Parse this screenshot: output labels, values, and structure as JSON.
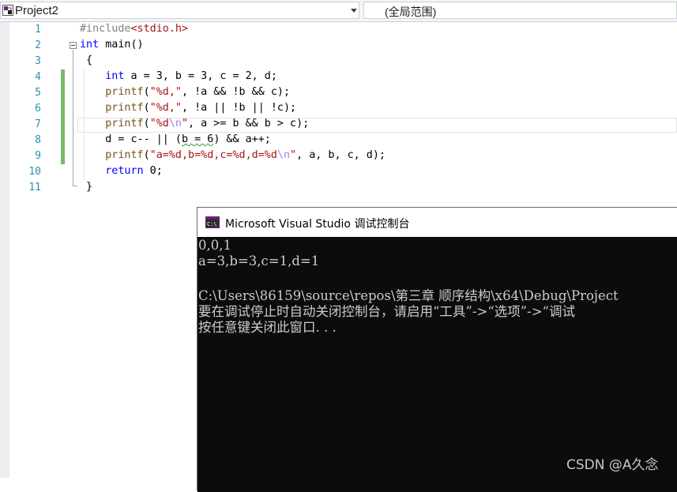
{
  "navbar": {
    "project": "Project2",
    "scope": "(全局范围)",
    "project_icon": "project-icon"
  },
  "editor": {
    "lines": [
      {
        "num": "1",
        "code": "#include<stdio.h>"
      },
      {
        "num": "2",
        "code": "int main()"
      },
      {
        "num": "3",
        "code": "{"
      },
      {
        "num": "4",
        "code": "int a = 3, b = 3, c = 2, d;"
      },
      {
        "num": "5",
        "code": "printf(\"%d,\", !a && !b && c);"
      },
      {
        "num": "6",
        "code": "printf(\"%d,\", !a || !b || !c);"
      },
      {
        "num": "7",
        "code": "printf(\"%d\\n\", a >= b && b > c);"
      },
      {
        "num": "8",
        "code": "d = c-- || (b = 6) && a++;"
      },
      {
        "num": "9",
        "code": "printf(\"a=%d,b=%d,c=%d,d=%d\\n\", a, b, c, d);"
      },
      {
        "num": "10",
        "code": "return 0;"
      },
      {
        "num": "11",
        "code": "}"
      }
    ],
    "colors": {
      "keyword": "#0000ff",
      "string": "#a31515",
      "preprocessor": "#808080",
      "line_number": "#2b91af",
      "change_marker": "#57a64a"
    }
  },
  "console": {
    "title": "Microsoft Visual Studio 调试控制台",
    "icon": "console-app-icon",
    "output": [
      "0,0,1",
      "a=3,b=3,c=1,d=1",
      "",
      "C:\\Users\\86159\\source\\repos\\第三章 顺序结构\\x64\\Debug\\Project",
      "要在调试停止时自动关闭控制台，请启用“工具”->“选项”->“调试",
      "按任意键关闭此窗口. . ."
    ]
  },
  "watermark": "CSDN @A久念"
}
